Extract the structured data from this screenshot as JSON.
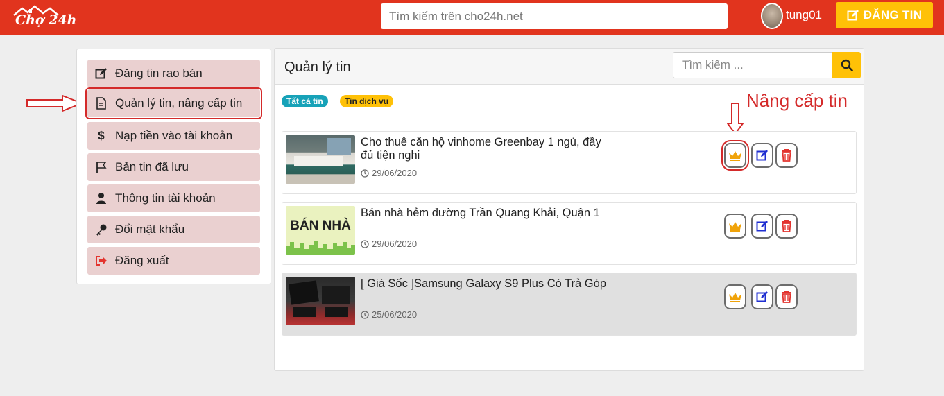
{
  "header": {
    "logo_text": "Chợ 24h",
    "search_placeholder": "Tìm kiếm trên cho24h.net",
    "username": "tung01",
    "post_button": "ĐĂNG TIN"
  },
  "sidebar": {
    "items": [
      {
        "label": "Đăng tin rao bán",
        "icon": "edit-icon"
      },
      {
        "label": "Quản lý tin, nâng cấp tin",
        "icon": "document-icon"
      },
      {
        "label": "Nạp tiền vào tài khoản",
        "icon": "dollar-icon"
      },
      {
        "label": "Bản tin đã lưu",
        "icon": "flag-icon"
      },
      {
        "label": "Thông tin tài khoản",
        "icon": "user-icon"
      },
      {
        "label": "Đổi mật khẩu",
        "icon": "key-icon"
      },
      {
        "label": "Đăng xuất",
        "icon": "sign-out-icon"
      }
    ]
  },
  "main": {
    "title": "Quản lý tin",
    "search_placeholder": "Tìm kiếm ...",
    "badges": [
      "Tất cả tin",
      "Tin dịch vụ"
    ],
    "annotation": "Nâng cấp tin",
    "listings": [
      {
        "title": "Cho thuê căn hộ vinhome Greenbay 1 ngủ, đầy đủ tiện nghi",
        "date": "29/06/2020"
      },
      {
        "title": "Bán nhà hẻm đường Trần Quang Khải, Quận 1",
        "date": "29/06/2020",
        "thumb_text": "BÁN NHÀ"
      },
      {
        "title": "[ Giá Sốc ]Samsung Galaxy S9 Plus Có Trả Góp",
        "date": "25/06/2020"
      }
    ]
  },
  "colors": {
    "header_bg": "#e1341e",
    "accent": "#ffc107",
    "sidebar_item_bg": "#ead0d0",
    "annotation": "#d42a2a",
    "badge_all": "#17a2b8"
  }
}
